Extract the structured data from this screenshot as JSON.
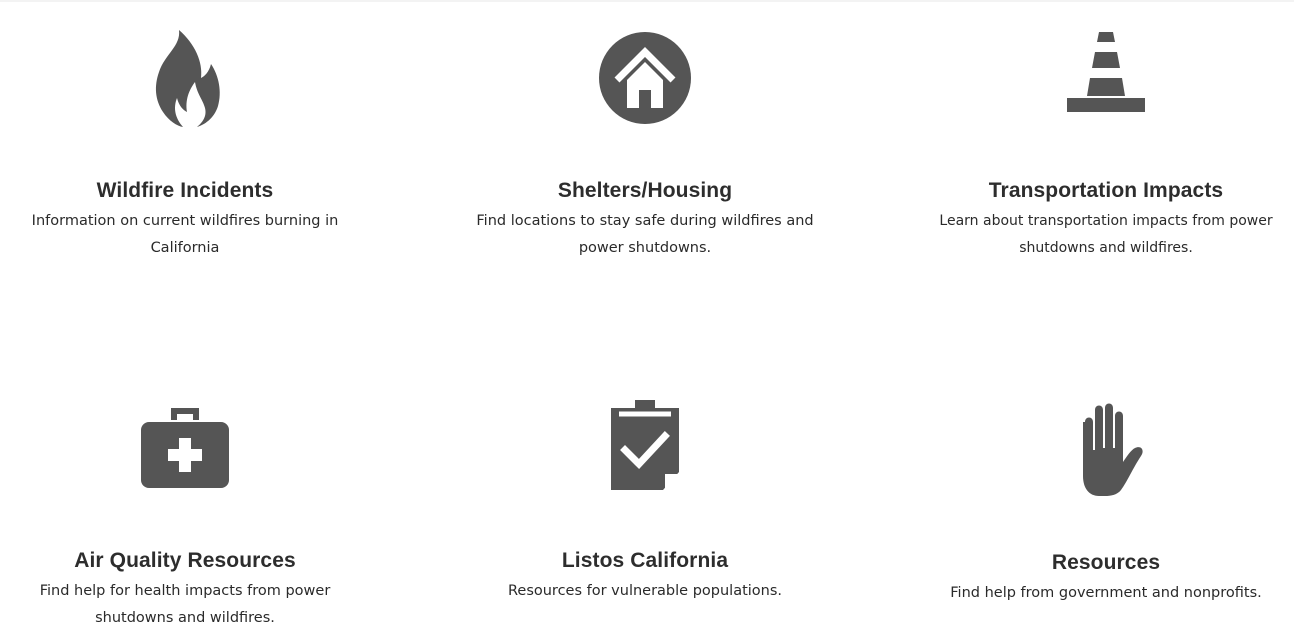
{
  "cards": [
    {
      "icon": "flame-icon",
      "title": "Wildfire Incidents",
      "desc_line1": "Information on current wildfires burning in",
      "desc_line2": "California"
    },
    {
      "icon": "house-circle-icon",
      "title": "Shelters/Housing",
      "desc_line1": "Find locations to stay safe during wildfires and",
      "desc_line2": "power shutdowns."
    },
    {
      "icon": "traffic-cone-icon",
      "title": "Transportation Impacts",
      "desc_line1": "Learn about transportation impacts from power",
      "desc_line2": "shutdowns and wildfires."
    },
    {
      "icon": "first-aid-kit-icon",
      "title": "Air Quality Resources",
      "desc_line1": "Find help for health impacts from power",
      "desc_line2": "shutdowns and wildfires."
    },
    {
      "icon": "clipboard-check-icon",
      "title": "Listos California",
      "desc_line1": "Resources for vulnerable populations.",
      "desc_line2": ""
    },
    {
      "icon": "hand-stop-icon",
      "title": "Resources",
      "desc_line1": "Find help from government and nonprofits.",
      "desc_line2": ""
    }
  ],
  "colors": {
    "icon": "#555555",
    "text": "#2a2a2a"
  }
}
